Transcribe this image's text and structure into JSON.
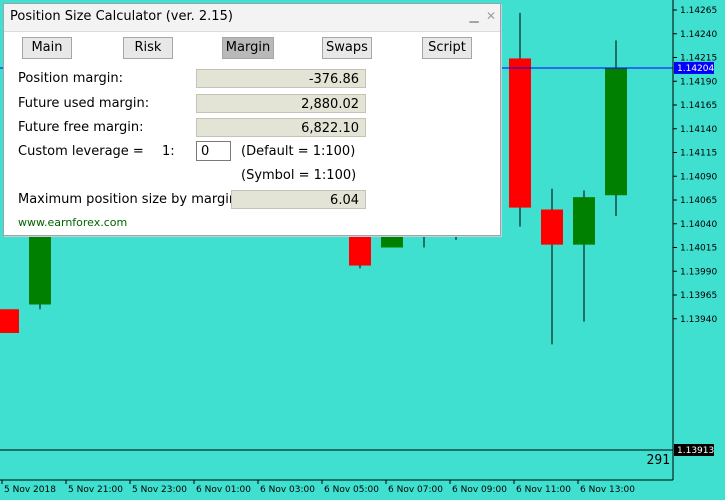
{
  "panel": {
    "title": "Position Size Calculator (ver. 2.15)",
    "tabs": [
      "Main",
      "Risk",
      "Margin",
      "Swaps",
      "Script"
    ],
    "active_tab": "Margin",
    "rows": {
      "position_margin_label": "Position margin:",
      "position_margin_value": "-376.86",
      "future_used_label": "Future used margin:",
      "future_used_value": "2,880.02",
      "future_free_label": "Future free margin:",
      "future_free_value": "6,822.10",
      "custom_leverage_label": "Custom leverage =",
      "leverage_prefix": "1:",
      "leverage_value": "0",
      "default_leverage": "(Default = 1:100)",
      "symbol_leverage": "(Symbol = 1:100)",
      "max_size_label": "Maximum position size by margin:",
      "max_size_value": "6.04"
    },
    "link": "www.earnforex.com"
  },
  "chart": {
    "background": "#40e0d0",
    "bull_color": "#008000",
    "bear_color": "#ff0000",
    "price_levels": [
      "1.14265",
      "1.14240",
      "1.14215",
      "1.14190",
      "1.14165",
      "1.14140",
      "1.14115",
      "1.14090",
      "1.14065",
      "1.14040",
      "1.14015",
      "1.13990",
      "1.13965",
      "1.13940"
    ],
    "current_price": "1.14204",
    "low_price": "1.13913",
    "counter": "291",
    "time_labels": [
      "5 Nov 2018",
      "5 Nov 21:00",
      "5 Nov 23:00",
      "6 Nov 01:00",
      "6 Nov 03:00",
      "6 Nov 05:00",
      "6 Nov 07:00",
      "6 Nov 09:00",
      "6 Nov 11:00",
      "6 Nov 13:00"
    ],
    "candles": [
      {
        "o": 1.1395,
        "h": 1.1395,
        "l": 1.13925,
        "c": 1.13925
      },
      {
        "o": 1.13955,
        "h": 1.142,
        "l": 1.1395,
        "c": 1.14195
      },
      {
        "o": 1.14075,
        "h": 1.1408,
        "l": 1.14073,
        "c": 1.14078
      },
      {
        "o": 1.14082,
        "h": 1.14083,
        "l": 1.14078,
        "c": 1.14079
      },
      {
        "o": 1.1408,
        "h": 1.14085,
        "l": 1.14073,
        "c": 1.14075
      },
      {
        "o": 1.14053,
        "h": 1.14083,
        "l": 1.14043,
        "c": 1.14082
      },
      {
        "o": 1.1408,
        "h": 1.14083,
        "l": 1.14063,
        "c": 1.14083
      },
      {
        "o": 1.14083,
        "h": 1.14083,
        "l": 1.14072,
        "c": 1.14083
      },
      {
        "o": 1.14082,
        "h": 1.14083,
        "l": 1.14058,
        "c": 1.14066
      },
      {
        "o": 1.14069,
        "h": 1.14083,
        "l": 1.14056,
        "c": 1.14083
      },
      {
        "o": 1.14083,
        "h": 1.14083,
        "l": 1.1404,
        "c": 1.14053
      },
      {
        "o": 1.14055,
        "h": 1.14055,
        "l": 1.13993,
        "c": 1.13996
      },
      {
        "o": 1.14015,
        "h": 1.14055,
        "l": 1.14015,
        "c": 1.14046
      },
      {
        "o": 1.14057,
        "h": 1.1411,
        "l": 1.14015,
        "c": 1.14083
      },
      {
        "o": 1.14083,
        "h": 1.14083,
        "l": 1.14023,
        "c": 1.14083
      },
      {
        "o": 1.14083,
        "h": 1.14083,
        "l": 1.14073,
        "c": 1.14083
      },
      {
        "o": 1.14214,
        "h": 1.14262,
        "l": 1.14037,
        "c": 1.14057
      },
      {
        "o": 1.14055,
        "h": 1.14077,
        "l": 1.13913,
        "c": 1.14018
      },
      {
        "o": 1.14018,
        "h": 1.14075,
        "l": 1.13937,
        "c": 1.14068
      },
      {
        "o": 1.1407,
        "h": 1.14233,
        "l": 1.14048,
        "c": 1.14204
      }
    ]
  }
}
